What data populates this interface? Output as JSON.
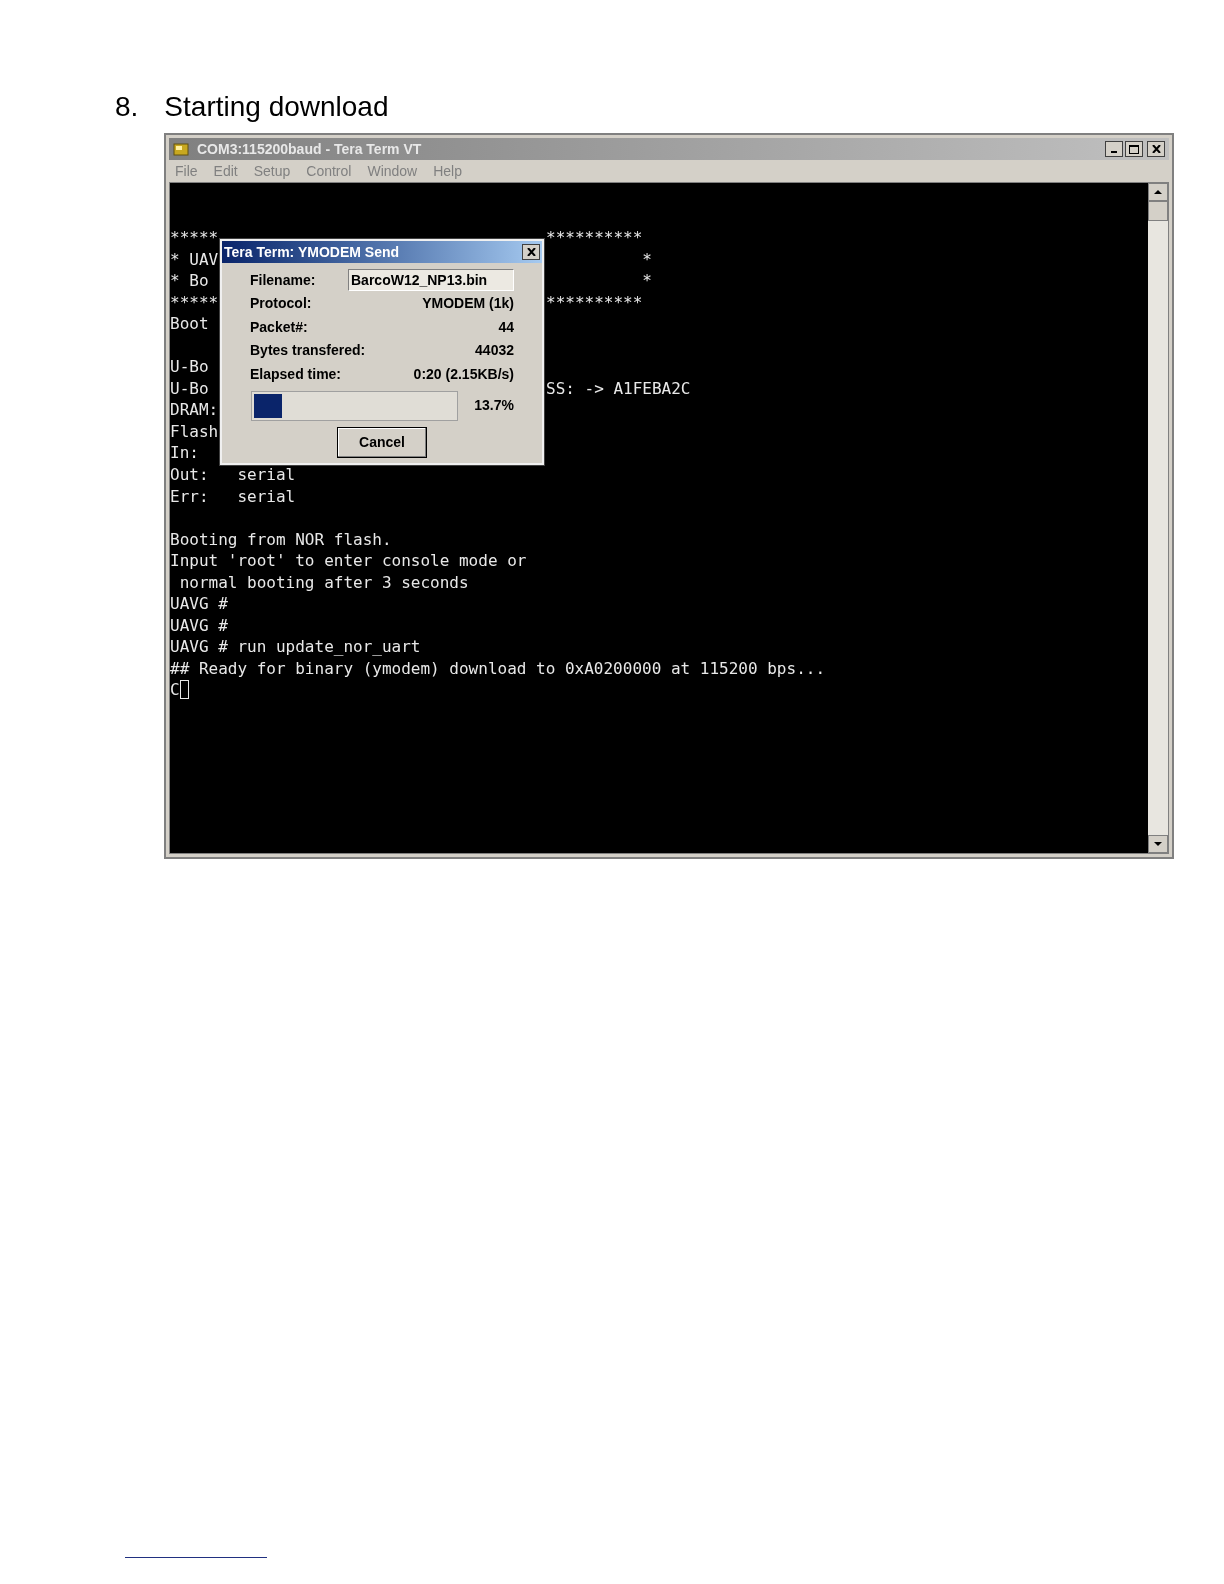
{
  "heading": {
    "number": "8.",
    "title": "Starting download"
  },
  "window": {
    "title": "COM3:115200baud - Tera Term VT",
    "menu": [
      "File",
      "Edit",
      "Setup",
      "Control",
      "Window",
      "Help"
    ],
    "terminal": {
      "lines": [
        {
          "kind": "text",
          "left": "*****",
          "right": "**********"
        },
        {
          "kind": "text",
          "left": "* UAV",
          "right": "          *"
        },
        {
          "kind": "text",
          "left": "* Bo",
          "right": "          *"
        },
        {
          "kind": "text",
          "left": "*****",
          "right": "**********"
        },
        {
          "kind": "text",
          "left": "Boot"
        },
        {
          "kind": "blank"
        },
        {
          "kind": "text",
          "left": "U-Bo"
        },
        {
          "kind": "text",
          "left": "U-Bo",
          "right": "SS: -> A1FEBA2C"
        },
        {
          "kind": "text",
          "left": "DRAM:"
        },
        {
          "kind": "text",
          "left": "Flash"
        },
        {
          "kind": "text",
          "left": "In:"
        },
        {
          "kind": "text",
          "left": "Out:   serial"
        },
        {
          "kind": "text",
          "left": "Err:   serial"
        },
        {
          "kind": "blank"
        },
        {
          "kind": "text",
          "left": "Booting from NOR flash."
        },
        {
          "kind": "text",
          "left": "Input 'root' to enter console mode or"
        },
        {
          "kind": "text",
          "left": " normal booting after 3 seconds"
        },
        {
          "kind": "text",
          "left": "UAVG #"
        },
        {
          "kind": "text",
          "left": "UAVG #"
        },
        {
          "kind": "text",
          "left": "UAVG # run update_nor_uart"
        },
        {
          "kind": "text",
          "left": "## Ready for binary (ymodem) download to 0xA0200000 at 115200 bps..."
        },
        {
          "kind": "text",
          "left": "C"
        }
      ]
    }
  },
  "dialog": {
    "title": "Tera Term: YMODEM Send",
    "fields": [
      {
        "kind": "input",
        "label": "Filename:",
        "value": "BarcoW12_NP13.bin"
      },
      {
        "kind": "text",
        "label": "Protocol:",
        "value": "YMODEM (1k)"
      },
      {
        "kind": "text",
        "label": "Packet#:",
        "value": "44"
      },
      {
        "kind": "text",
        "label": "Bytes transfered:",
        "value": "44032"
      },
      {
        "kind": "text",
        "label": "Elapsed time:",
        "value": "0:20 (2.15KB/s)"
      }
    ],
    "progress": {
      "level": 0.137,
      "reading": "13.7%"
    },
    "buttons": [
      "Cancel"
    ]
  }
}
